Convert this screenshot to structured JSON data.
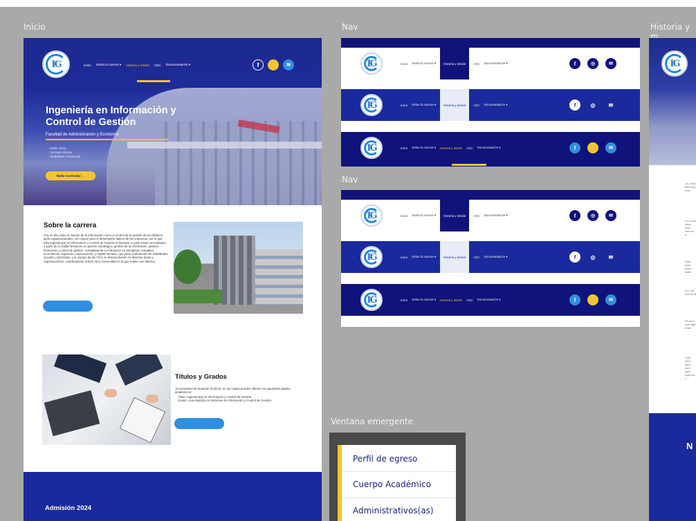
{
  "labels": {
    "inicio": "Inicio",
    "nav1": "Nav",
    "nav2": "Nav",
    "historia": "Historia y m",
    "popup": "Ventana emergente"
  },
  "logo_text": "IG",
  "nav": {
    "items": [
      "Inicio",
      "Sobre la carrera ▾",
      "Historia y misión",
      "CEC",
      "Documentación ▾"
    ],
    "active_index": 2
  },
  "social_icons": [
    "facebook-icon",
    "instagram-icon",
    "mail-icon"
  ],
  "hero": {
    "title": "Ingeniería en Información y Control de Gestión",
    "faculty": "Facultad de Administración y Economía",
    "facts": [
      "- Sede: Arica",
      "- Jornada: Diurna",
      "- Modalidad: Presencial"
    ],
    "cta": "Malla Curricular →"
  },
  "about": {
    "title": "Sobre la carrera",
    "text": "Hoy en día, tanto el manejo de la información como el control de la gestión de los distintos tipos organizacionales, son claves para el desempeño óptimo de las empresas, por lo que el/la Ingeniero(a) en Información y Control de Gestión es llamado a cubrir estas necesidades, a partir de la sólida formación en gestión estratégica, gestión de la información, gestión financiera y control de gestión. Complementa su formación en disciplinas contables, económicas, logísticas y operaciones, y capital humano, que junto al desarrollo de habilidades sociales y directivas, y el manejo de las TICs se desenvolverán en diversas áreas y organizaciones, contribuyendo al bien de la comunidad en la que realice sus labores."
  },
  "titles": {
    "title": "Títulos y Grados",
    "intro": "10 semestres de duración (5 años), en los cuales puedes obtener los siguientes grados académicos:",
    "items": [
      "Título: Ingeniero(a) en Información y Control de Gestión.",
      "Grado: Licenciado(a) en Sistemas de Información y Control de Gestión."
    ]
  },
  "admission": "Admisión 2024",
  "popup_menu": [
    "Perfil de egreso",
    "Cuerpo Académico",
    "Administrativos(as)"
  ],
  "historia_partial": {
    "paragraphs": [
      "La c fina Info emp mun",
      "Lo a prof espe proc com su e",
      "Esta prep mism aden",
      "En r de Dire la fa",
      "Es acre cum Age ense",
      "Com ACG esta med sólic orga los c"
    ],
    "heading": "N"
  },
  "colors": {
    "canvas": "#a9a9a9",
    "primary_blue": "#1a2a9c",
    "dark_navy": "#10137a",
    "accent_yellow": "#f3c52f",
    "button_blue": "#2f8fe0"
  }
}
